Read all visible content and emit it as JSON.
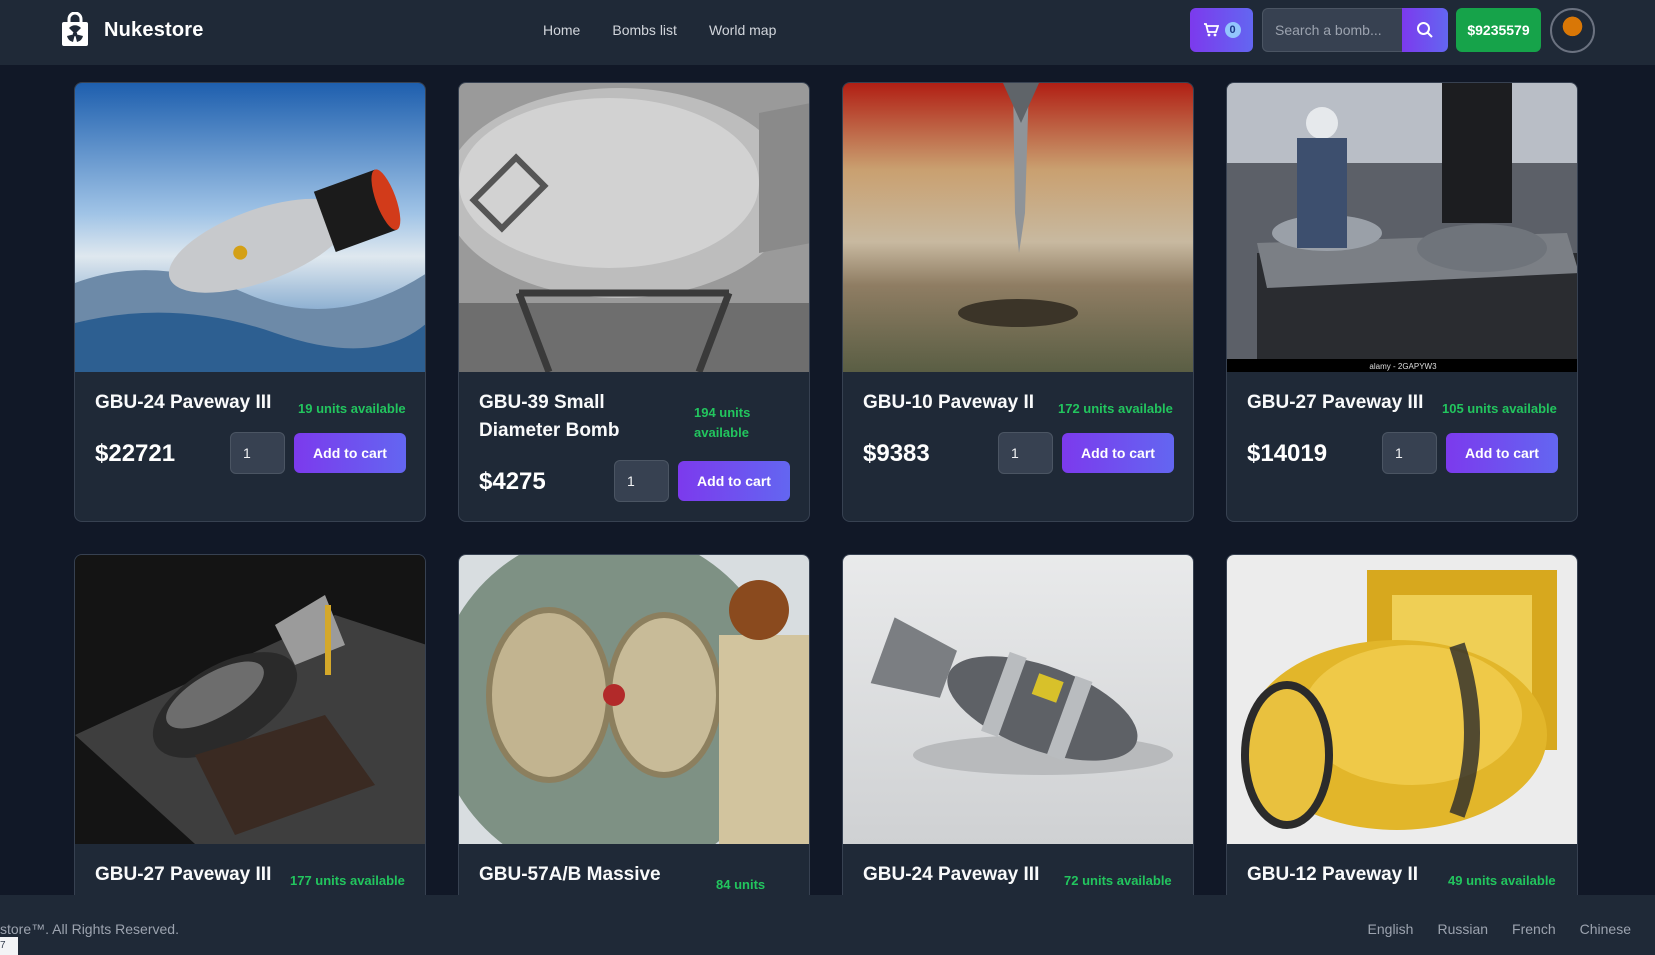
{
  "header": {
    "brand": "Nukestore",
    "nav": [
      "Home",
      "Bombs list",
      "World map"
    ],
    "cart_count": "0",
    "search_placeholder": "Search a bomb...",
    "balance": "$9235579"
  },
  "products": [
    {
      "name": "GBU-24 Paveway III",
      "stock": "19 units available",
      "price": "$22721",
      "qty": "1",
      "button": "Add to cart"
    },
    {
      "name": "GBU-39 Small Diameter Bomb",
      "stock": "194 units available",
      "price": "$4275",
      "qty": "1",
      "button": "Add to cart"
    },
    {
      "name": "GBU-10 Paveway II",
      "stock": "172 units available",
      "price": "$9383",
      "qty": "1",
      "button": "Add to cart"
    },
    {
      "name": "GBU-27 Paveway III",
      "stock": "105 units available",
      "price": "$14019",
      "qty": "1",
      "button": "Add to cart",
      "image_caption": "alamy - 2GAPYW3"
    },
    {
      "name": "GBU-27 Paveway III",
      "stock": "177 units available"
    },
    {
      "name": "GBU-57A/B Massive",
      "stock": "84 units"
    },
    {
      "name": "GBU-24 Paveway III",
      "stock": "72 units available"
    },
    {
      "name": "GBU-12 Paveway II",
      "stock": "49 units available"
    }
  ],
  "footer": {
    "copyright": "store™. All Rights Reserved.",
    "languages": [
      "English",
      "Russian",
      "French",
      "Chinese"
    ],
    "corner_text": "7"
  },
  "colors": {
    "background": "#111827",
    "surface": "#1f2937",
    "accent": "#7c3aed",
    "stock_green": "#22c55e",
    "balance_green": "#16a34a"
  }
}
